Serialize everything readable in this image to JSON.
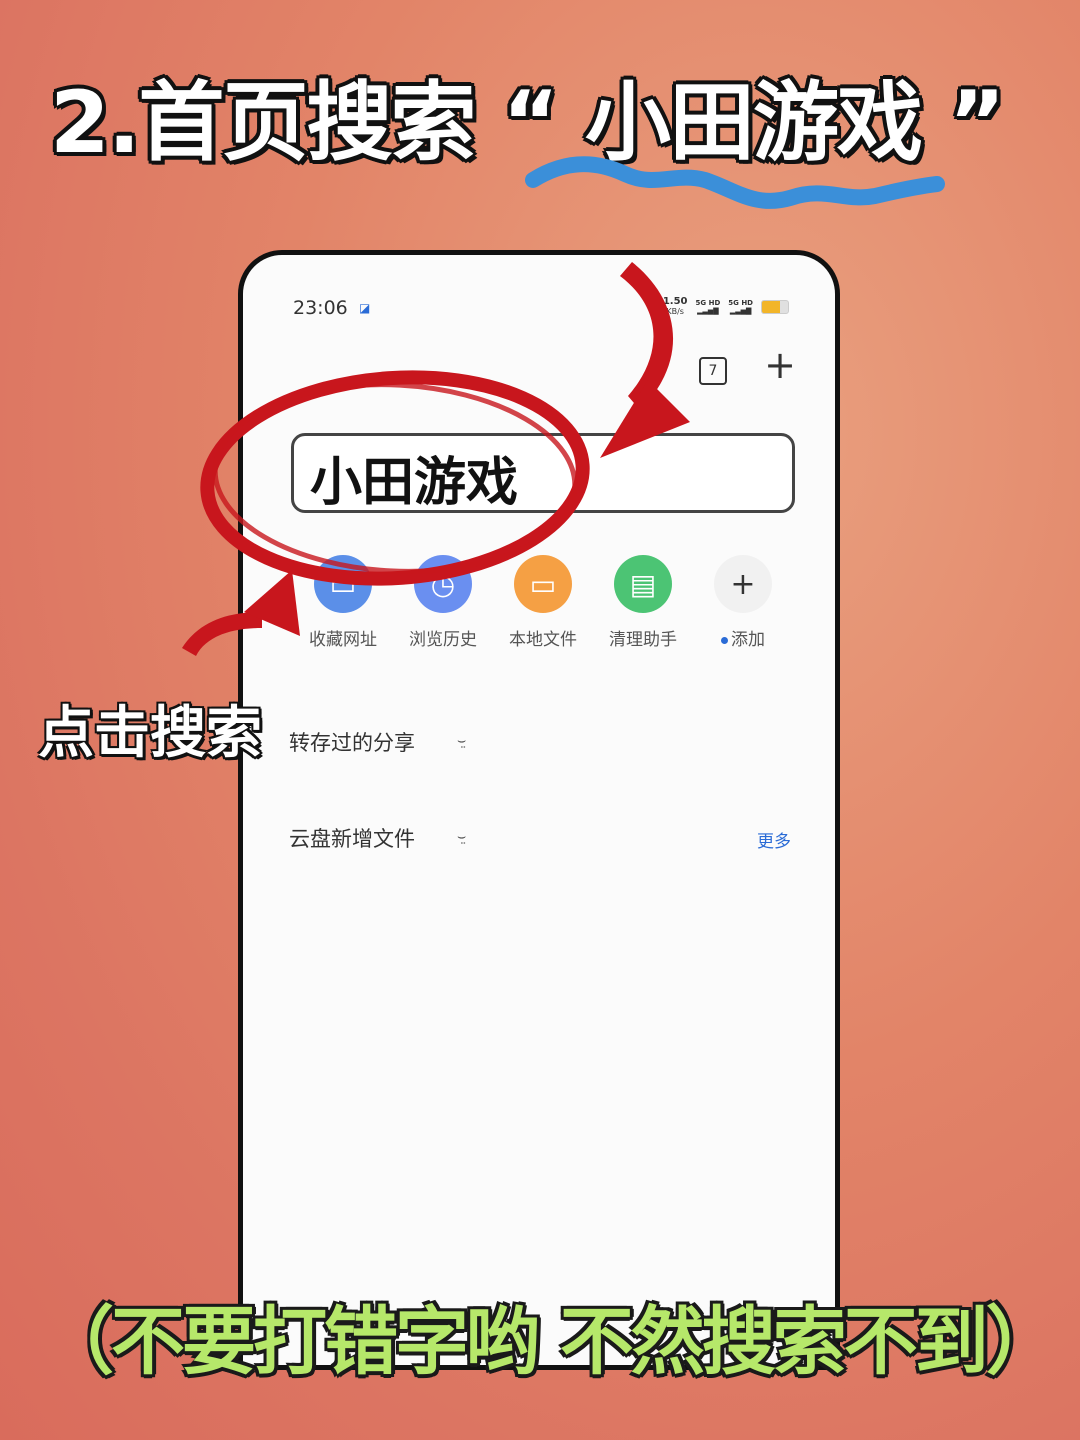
{
  "headline": {
    "step": "2.首页搜索",
    "open_quote": "“",
    "keyword": "小田游戏",
    "close_quote": "”"
  },
  "status_bar": {
    "time": "23:06",
    "net_speed_value": "1.50",
    "net_speed_unit": "KB/s",
    "signal_1": "5G HD",
    "signal_2": "5G HD"
  },
  "toolbar": {
    "tab_count": "7",
    "add_tab": "+"
  },
  "search": {
    "value": "小田游戏"
  },
  "quick_actions": [
    {
      "label": "收藏网址",
      "icon": "bookmark-icon",
      "color": "#5b8fe8"
    },
    {
      "label": "浏览历史",
      "icon": "history-icon",
      "color": "#6a8ff0"
    },
    {
      "label": "本地文件",
      "icon": "folder-icon",
      "color": "#f5a044"
    },
    {
      "label": "清理助手",
      "icon": "clean-icon",
      "color": "#4cc474"
    },
    {
      "label": "添加",
      "icon": "plus-icon",
      "color": "#f1f1f1",
      "glyph": "+"
    }
  ],
  "sections": [
    {
      "title": "转存过的分享"
    },
    {
      "title": "云盘新增文件",
      "more": "更多"
    }
  ],
  "annotations": {
    "tap_label": "点击搜索",
    "bottom_note": "（不要打错字哟 不然搜索不到）",
    "circle_color": "#c8161d",
    "arrow_color": "#c8161d",
    "squiggle_color": "#3b8fd9"
  }
}
